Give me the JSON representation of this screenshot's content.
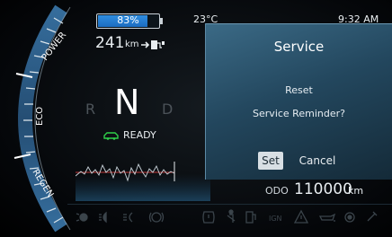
{
  "status_bar": {
    "battery_percent": "83%",
    "battery_level": 0.83,
    "temperature": "23°C",
    "time": "9:32 AM"
  },
  "range": {
    "value": "241",
    "unit": "km"
  },
  "gauge": {
    "power_label": "POWER",
    "eco_label": "ECO",
    "regen_label": "REGEN"
  },
  "gear": {
    "reverse": "R",
    "neutral": "N",
    "drive": "D"
  },
  "ready": {
    "label": "READY",
    "color": "#2fd04a"
  },
  "service": {
    "title": "Service",
    "line1": "Reset",
    "line2": "Service Reminder?",
    "set_label": "Set",
    "cancel_label": "Cancel"
  },
  "odo": {
    "label": "ODO",
    "value": "110000",
    "unit": "km"
  },
  "telltales": [
    "parking-light-icon",
    "low-beam-icon",
    "fog-light-icon",
    "brake-warning-icon",
    "tpms-icon",
    "seatbelt-icon",
    "fuel-door-icon",
    "ign-indicator",
    "hazard-warning-icon",
    "oil-pressure-icon",
    "abs-icon",
    "wrench-icon"
  ],
  "telltale_texts": {
    "ign": "IGN"
  },
  "colors": {
    "accent": "#2f8de0",
    "ready_green": "#2fd04a",
    "dialog": "#2b5570"
  }
}
